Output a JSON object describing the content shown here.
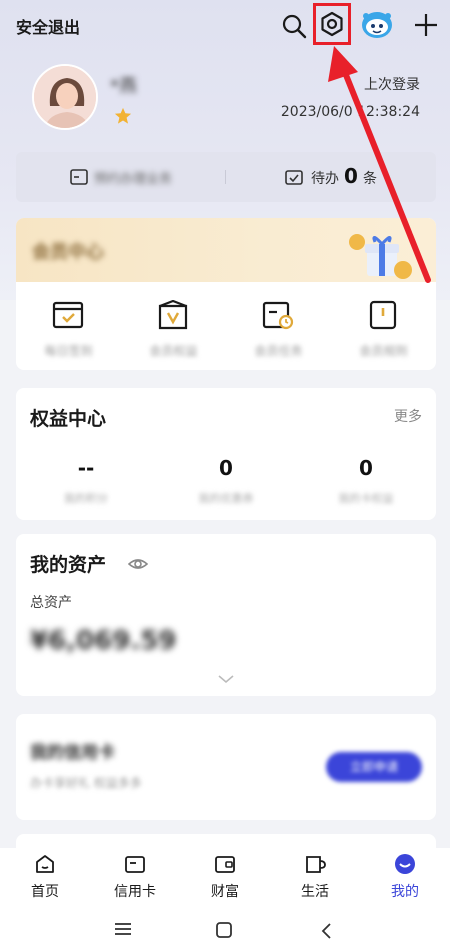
{
  "header": {
    "logout_label": "安全退出",
    "icons": [
      "search-icon",
      "settings-icon",
      "assistant-robot-icon",
      "plus-icon"
    ],
    "highlight_color": "#e8202a"
  },
  "profile": {
    "username": "*燕",
    "last_login_label": "上次登录",
    "last_login_time": "2023/06/0 12:38:24"
  },
  "pending": {
    "left_label": "预约办理业务",
    "todo_label": "待办",
    "todo_count": "0",
    "todo_unit": "条"
  },
  "vip": {
    "title": "会员中心",
    "items": [
      {
        "label": "每日签到",
        "icon": "calendar-check-icon"
      },
      {
        "label": "会员权益",
        "icon": "voucher-icon"
      },
      {
        "label": "会员任务",
        "icon": "task-clock-icon"
      },
      {
        "label": "会员规则",
        "icon": "book-icon"
      }
    ]
  },
  "rights": {
    "title": "权益中心",
    "more": "更多",
    "items": [
      {
        "value": "--",
        "label": "我的积分"
      },
      {
        "value": "0",
        "label": "我的优惠券"
      },
      {
        "value": "0",
        "label": "我的卡权益"
      }
    ]
  },
  "assets": {
    "title": "我的资产",
    "total_label": "总资产",
    "total_value": "¥6,069.59"
  },
  "credit": {
    "title": "我的信用卡",
    "subtitle": "办卡享好礼 权益多多",
    "apply_label": "立即申请"
  },
  "tabs": [
    {
      "label": "首页",
      "icon": "home-icon"
    },
    {
      "label": "信用卡",
      "icon": "credit-card-icon"
    },
    {
      "label": "财富",
      "icon": "wallet-icon"
    },
    {
      "label": "生活",
      "icon": "cup-icon"
    },
    {
      "label": "我的",
      "icon": "profile-icon",
      "active": true
    }
  ],
  "colors": {
    "accent": "#3b45d9",
    "vip_gold": "#e0a93a"
  }
}
